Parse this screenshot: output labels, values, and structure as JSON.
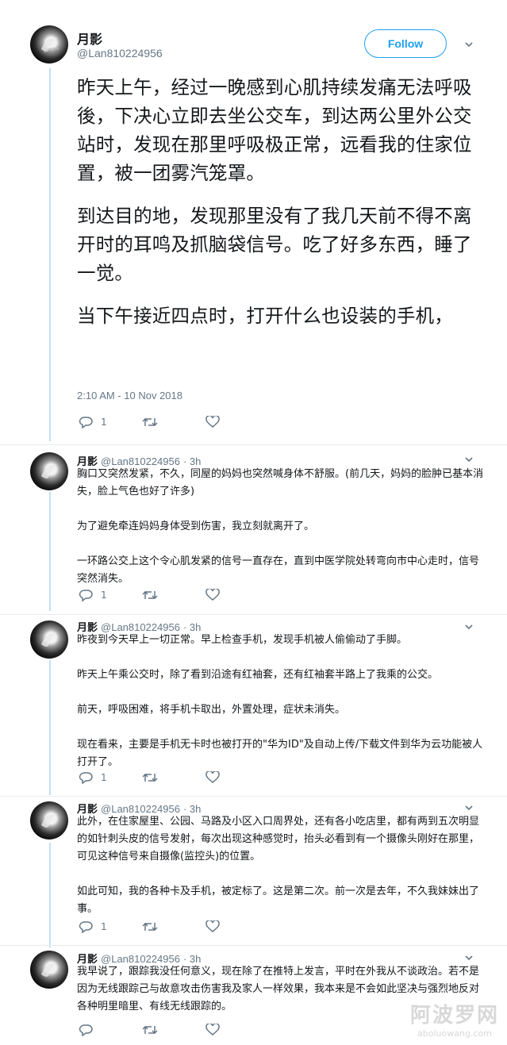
{
  "main_tweet": {
    "name": "月影",
    "handle": "@Lan810224956",
    "follow_label": "Follow",
    "paragraphs": [
      "昨天上午，经过一晚感到心肌持续发痛无法呼吸後，下决心立即去坐公交车，到达两公里外公交站时，发现在那里呼吸极正常，远看我的住家位置，被一团雾汽笼罩。",
      "到达目的地，发现那里没有了我几天前不得不离开时的耳鸣及抓脑袋信号。吃了好多东西，睡了一觉。",
      "当下午接近四点时，打开什么也设装的手机，"
    ],
    "timestamp": "2:10 AM - 10 Nov 2018",
    "reply_count": "1"
  },
  "replies": [
    {
      "name": "月影",
      "handle": "@Lan810224956",
      "time": "· 3h",
      "paragraphs": [
        "胸口又突然发紧，不久，同屋的妈妈也突然喊身体不舒服。(前几天，妈妈的脸肿已基本消失，脸上气色也好了许多)",
        "为了避免牵连妈妈身体受到伤害，我立刻就离开了。",
        "一环路公交上这个令心肌发紧的信号一直存在，直到中医学院处转弯向市中心走时，信号突然消失。"
      ],
      "reply_count": "1"
    },
    {
      "name": "月影",
      "handle": "@Lan810224956",
      "time": "· 3h",
      "paragraphs": [
        "昨夜到今天早上一切正常。早上检查手机，发现手机被人偷偷动了手脚。",
        "昨天上午乘公交时，除了看到沿途有红袖套，还有红袖套半路上了我乘的公交。",
        "前天，呼吸困难，将手机卡取出，外置处理，症状未消失。",
        "现在看来，主要是手机无卡时也被打开的\"华为ID\"及自动上传/下载文件到华为云功能被人打开了。"
      ],
      "reply_count": "1"
    },
    {
      "name": "月影",
      "handle": "@Lan810224956",
      "time": "· 3h",
      "paragraphs": [
        "此外，在住家屋里、公园、马路及小区入口周界处，还有各小吃店里，都有两到五次明显的如针刺头皮的信号发射，每次出现这种感觉时，抬头必看到有一个摄像头刚好在那里，可见这种信号来自摄像(监控头)的位置。",
        "如此可知，我的各种卡及手机，被定标了。这是第二次。前一次是去年，不久我妹妹出了事。"
      ],
      "reply_count": "1"
    },
    {
      "name": "月影",
      "handle": "@Lan810224956",
      "time": "· 3h",
      "paragraphs": [
        "我早说了，跟踪我没任何意义，现在除了在推特上发言，平时在外我从不谈政治。若不是因为无线跟踪己与故意攻击伤害我及家人一样效果，我本来是不会如此坚决与强烈地反对各种明里暗里、有线无线跟踪的。"
      ],
      "reply_count": ""
    }
  ],
  "watermark": {
    "cn": "阿波罗网",
    "url": "aboluowang.com"
  },
  "colors": {
    "accent": "#1da1f2",
    "thread_line": "#c4dff6",
    "muted": "#657786"
  }
}
